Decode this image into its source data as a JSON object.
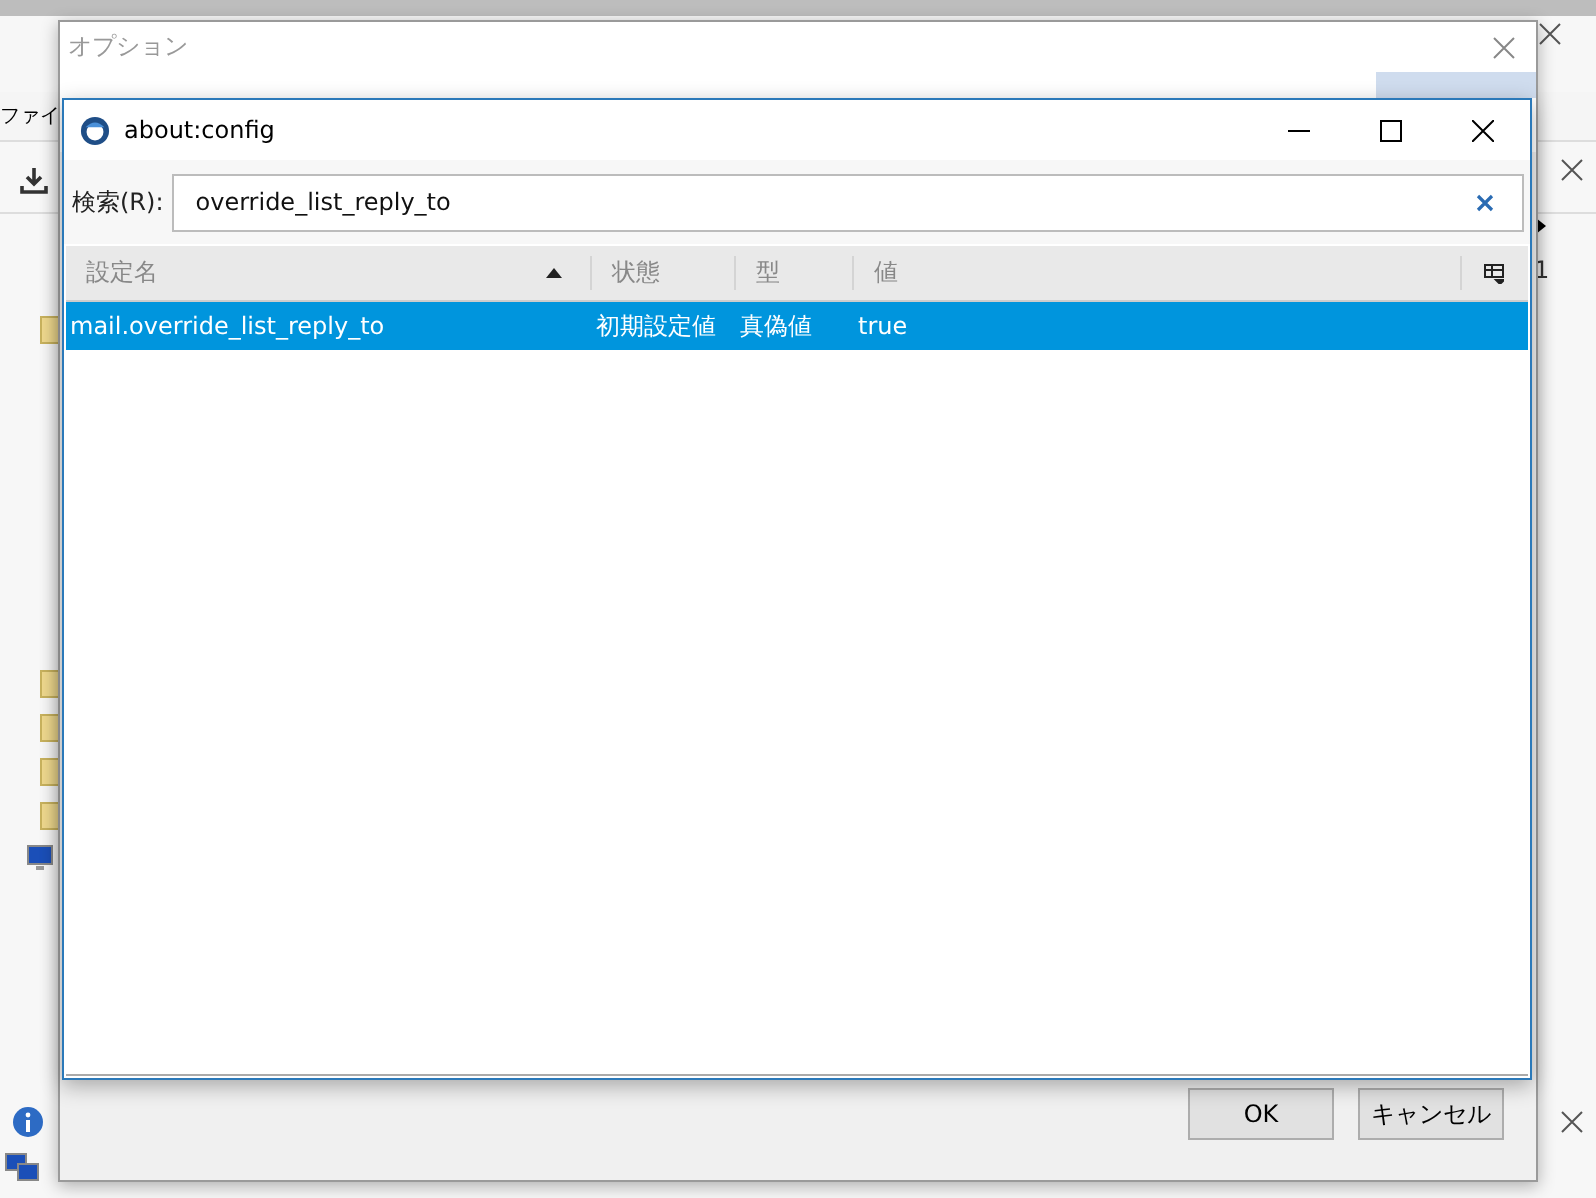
{
  "main_window": {
    "menu_text": "ファイ",
    "side_text": "1"
  },
  "options_window": {
    "title": "オプション",
    "buttons": [
      {
        "label": "OK"
      },
      {
        "label": "キャンセル"
      }
    ]
  },
  "config_window": {
    "title": "about:config",
    "search": {
      "label": "検索(R):",
      "value": "override_list_reply_to"
    },
    "columns": [
      {
        "label": "設定名",
        "sorted": true
      },
      {
        "label": "状態",
        "sorted": false
      },
      {
        "label": "型",
        "sorted": false
      },
      {
        "label": "値",
        "sorted": false
      }
    ],
    "rows": [
      {
        "name": "mail.override_list_reply_to",
        "status": "初期設定値",
        "type": "真偽値",
        "value": "true",
        "selected": true
      }
    ]
  }
}
